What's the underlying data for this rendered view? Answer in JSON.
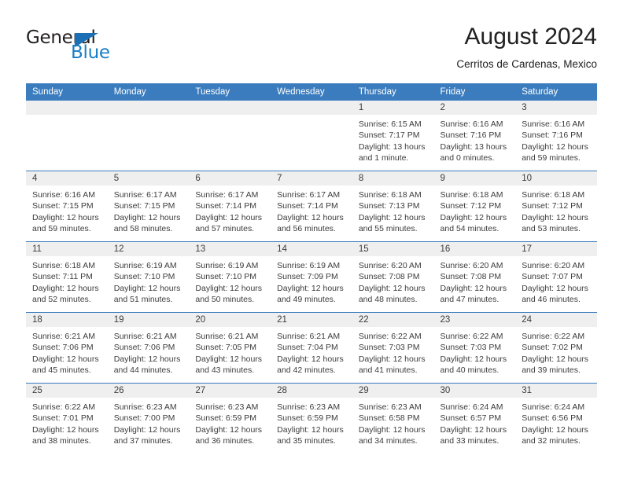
{
  "brand": {
    "name_part1": "General",
    "name_part2": "Blue",
    "accent_color": "#1a7dc4",
    "triangle_color": "#1a6fb5"
  },
  "header": {
    "title": "August 2024",
    "location": "Cerritos de Cardenas, Mexico",
    "header_bg_color": "#3a7cbe",
    "daynum_band_color": "#efefef"
  },
  "weekday_headers": [
    "Sunday",
    "Monday",
    "Tuesday",
    "Wednesday",
    "Thursday",
    "Friday",
    "Saturday"
  ],
  "weeks": [
    [
      {
        "day": "",
        "empty": true,
        "sunrise": "",
        "sunset": "",
        "daylight_line1": "",
        "daylight_line2": ""
      },
      {
        "day": "",
        "empty": true,
        "sunrise": "",
        "sunset": "",
        "daylight_line1": "",
        "daylight_line2": ""
      },
      {
        "day": "",
        "empty": true,
        "sunrise": "",
        "sunset": "",
        "daylight_line1": "",
        "daylight_line2": ""
      },
      {
        "day": "",
        "empty": true,
        "sunrise": "",
        "sunset": "",
        "daylight_line1": "",
        "daylight_line2": ""
      },
      {
        "day": "1",
        "empty": false,
        "sunrise": "Sunrise: 6:15 AM",
        "sunset": "Sunset: 7:17 PM",
        "daylight_line1": "Daylight: 13 hours",
        "daylight_line2": "and 1 minute."
      },
      {
        "day": "2",
        "empty": false,
        "sunrise": "Sunrise: 6:16 AM",
        "sunset": "Sunset: 7:16 PM",
        "daylight_line1": "Daylight: 13 hours",
        "daylight_line2": "and 0 minutes."
      },
      {
        "day": "3",
        "empty": false,
        "sunrise": "Sunrise: 6:16 AM",
        "sunset": "Sunset: 7:16 PM",
        "daylight_line1": "Daylight: 12 hours",
        "daylight_line2": "and 59 minutes."
      }
    ],
    [
      {
        "day": "4",
        "empty": false,
        "sunrise": "Sunrise: 6:16 AM",
        "sunset": "Sunset: 7:15 PM",
        "daylight_line1": "Daylight: 12 hours",
        "daylight_line2": "and 59 minutes."
      },
      {
        "day": "5",
        "empty": false,
        "sunrise": "Sunrise: 6:17 AM",
        "sunset": "Sunset: 7:15 PM",
        "daylight_line1": "Daylight: 12 hours",
        "daylight_line2": "and 58 minutes."
      },
      {
        "day": "6",
        "empty": false,
        "sunrise": "Sunrise: 6:17 AM",
        "sunset": "Sunset: 7:14 PM",
        "daylight_line1": "Daylight: 12 hours",
        "daylight_line2": "and 57 minutes."
      },
      {
        "day": "7",
        "empty": false,
        "sunrise": "Sunrise: 6:17 AM",
        "sunset": "Sunset: 7:14 PM",
        "daylight_line1": "Daylight: 12 hours",
        "daylight_line2": "and 56 minutes."
      },
      {
        "day": "8",
        "empty": false,
        "sunrise": "Sunrise: 6:18 AM",
        "sunset": "Sunset: 7:13 PM",
        "daylight_line1": "Daylight: 12 hours",
        "daylight_line2": "and 55 minutes."
      },
      {
        "day": "9",
        "empty": false,
        "sunrise": "Sunrise: 6:18 AM",
        "sunset": "Sunset: 7:12 PM",
        "daylight_line1": "Daylight: 12 hours",
        "daylight_line2": "and 54 minutes."
      },
      {
        "day": "10",
        "empty": false,
        "sunrise": "Sunrise: 6:18 AM",
        "sunset": "Sunset: 7:12 PM",
        "daylight_line1": "Daylight: 12 hours",
        "daylight_line2": "and 53 minutes."
      }
    ],
    [
      {
        "day": "11",
        "empty": false,
        "sunrise": "Sunrise: 6:18 AM",
        "sunset": "Sunset: 7:11 PM",
        "daylight_line1": "Daylight: 12 hours",
        "daylight_line2": "and 52 minutes."
      },
      {
        "day": "12",
        "empty": false,
        "sunrise": "Sunrise: 6:19 AM",
        "sunset": "Sunset: 7:10 PM",
        "daylight_line1": "Daylight: 12 hours",
        "daylight_line2": "and 51 minutes."
      },
      {
        "day": "13",
        "empty": false,
        "sunrise": "Sunrise: 6:19 AM",
        "sunset": "Sunset: 7:10 PM",
        "daylight_line1": "Daylight: 12 hours",
        "daylight_line2": "and 50 minutes."
      },
      {
        "day": "14",
        "empty": false,
        "sunrise": "Sunrise: 6:19 AM",
        "sunset": "Sunset: 7:09 PM",
        "daylight_line1": "Daylight: 12 hours",
        "daylight_line2": "and 49 minutes."
      },
      {
        "day": "15",
        "empty": false,
        "sunrise": "Sunrise: 6:20 AM",
        "sunset": "Sunset: 7:08 PM",
        "daylight_line1": "Daylight: 12 hours",
        "daylight_line2": "and 48 minutes."
      },
      {
        "day": "16",
        "empty": false,
        "sunrise": "Sunrise: 6:20 AM",
        "sunset": "Sunset: 7:08 PM",
        "daylight_line1": "Daylight: 12 hours",
        "daylight_line2": "and 47 minutes."
      },
      {
        "day": "17",
        "empty": false,
        "sunrise": "Sunrise: 6:20 AM",
        "sunset": "Sunset: 7:07 PM",
        "daylight_line1": "Daylight: 12 hours",
        "daylight_line2": "and 46 minutes."
      }
    ],
    [
      {
        "day": "18",
        "empty": false,
        "sunrise": "Sunrise: 6:21 AM",
        "sunset": "Sunset: 7:06 PM",
        "daylight_line1": "Daylight: 12 hours",
        "daylight_line2": "and 45 minutes."
      },
      {
        "day": "19",
        "empty": false,
        "sunrise": "Sunrise: 6:21 AM",
        "sunset": "Sunset: 7:06 PM",
        "daylight_line1": "Daylight: 12 hours",
        "daylight_line2": "and 44 minutes."
      },
      {
        "day": "20",
        "empty": false,
        "sunrise": "Sunrise: 6:21 AM",
        "sunset": "Sunset: 7:05 PM",
        "daylight_line1": "Daylight: 12 hours",
        "daylight_line2": "and 43 minutes."
      },
      {
        "day": "21",
        "empty": false,
        "sunrise": "Sunrise: 6:21 AM",
        "sunset": "Sunset: 7:04 PM",
        "daylight_line1": "Daylight: 12 hours",
        "daylight_line2": "and 42 minutes."
      },
      {
        "day": "22",
        "empty": false,
        "sunrise": "Sunrise: 6:22 AM",
        "sunset": "Sunset: 7:03 PM",
        "daylight_line1": "Daylight: 12 hours",
        "daylight_line2": "and 41 minutes."
      },
      {
        "day": "23",
        "empty": false,
        "sunrise": "Sunrise: 6:22 AM",
        "sunset": "Sunset: 7:03 PM",
        "daylight_line1": "Daylight: 12 hours",
        "daylight_line2": "and 40 minutes."
      },
      {
        "day": "24",
        "empty": false,
        "sunrise": "Sunrise: 6:22 AM",
        "sunset": "Sunset: 7:02 PM",
        "daylight_line1": "Daylight: 12 hours",
        "daylight_line2": "and 39 minutes."
      }
    ],
    [
      {
        "day": "25",
        "empty": false,
        "sunrise": "Sunrise: 6:22 AM",
        "sunset": "Sunset: 7:01 PM",
        "daylight_line1": "Daylight: 12 hours",
        "daylight_line2": "and 38 minutes."
      },
      {
        "day": "26",
        "empty": false,
        "sunrise": "Sunrise: 6:23 AM",
        "sunset": "Sunset: 7:00 PM",
        "daylight_line1": "Daylight: 12 hours",
        "daylight_line2": "and 37 minutes."
      },
      {
        "day": "27",
        "empty": false,
        "sunrise": "Sunrise: 6:23 AM",
        "sunset": "Sunset: 6:59 PM",
        "daylight_line1": "Daylight: 12 hours",
        "daylight_line2": "and 36 minutes."
      },
      {
        "day": "28",
        "empty": false,
        "sunrise": "Sunrise: 6:23 AM",
        "sunset": "Sunset: 6:59 PM",
        "daylight_line1": "Daylight: 12 hours",
        "daylight_line2": "and 35 minutes."
      },
      {
        "day": "29",
        "empty": false,
        "sunrise": "Sunrise: 6:23 AM",
        "sunset": "Sunset: 6:58 PM",
        "daylight_line1": "Daylight: 12 hours",
        "daylight_line2": "and 34 minutes."
      },
      {
        "day": "30",
        "empty": false,
        "sunrise": "Sunrise: 6:24 AM",
        "sunset": "Sunset: 6:57 PM",
        "daylight_line1": "Daylight: 12 hours",
        "daylight_line2": "and 33 minutes."
      },
      {
        "day": "31",
        "empty": false,
        "sunrise": "Sunrise: 6:24 AM",
        "sunset": "Sunset: 6:56 PM",
        "daylight_line1": "Daylight: 12 hours",
        "daylight_line2": "and 32 minutes."
      }
    ]
  ]
}
